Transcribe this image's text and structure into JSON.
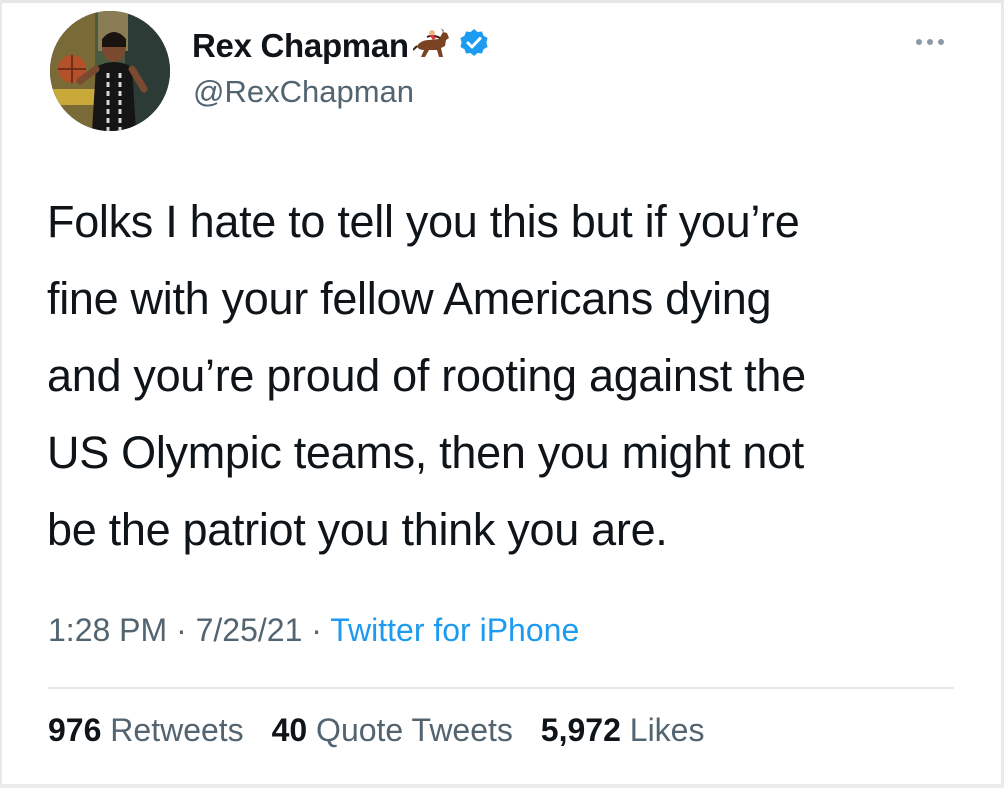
{
  "author": {
    "display_name": "Rex Chapman",
    "handle": "@RexChapman"
  },
  "tweet": {
    "lines": [
      "Folks I hate to tell you this but if you’re",
      "fine with your fellow Americans dying",
      "and you’re proud of rooting against the",
      "US Olympic teams, then you might not",
      "be the patriot you think you are."
    ]
  },
  "meta": {
    "time": "1:28 PM",
    "separator": "·",
    "date": "7/25/21",
    "source": "Twitter for iPhone"
  },
  "stats": {
    "retweets_count": "976",
    "retweets_label": "Retweets",
    "quotes_count": "40",
    "quotes_label": "Quote Tweets",
    "likes_count": "5,972",
    "likes_label": "Likes"
  },
  "icons": {
    "name_emoji": "horse-racing-icon",
    "verified": "verified-badge-icon",
    "more": "more-options-icon"
  },
  "colors": {
    "text": "#0f1419",
    "secondary": "#536471",
    "link": "#1d9bf0",
    "verified": "#1d9bf0"
  }
}
